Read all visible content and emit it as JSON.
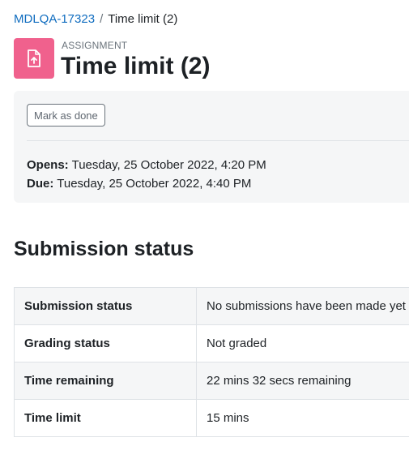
{
  "breadcrumb": {
    "course": "MDLQA-17323",
    "separator": "/",
    "current": "Time limit (2)"
  },
  "header": {
    "module_icon": "assignment-upload-icon",
    "module_icon_color": "#f0618d",
    "module_type": "ASSIGNMENT",
    "title": "Time limit (2)"
  },
  "activity": {
    "mark_done_label": "Mark as done",
    "opens_label": "Opens:",
    "opens_value": "Tuesday, 25 October 2022, 4:20 PM",
    "due_label": "Due:",
    "due_value": "Tuesday, 25 October 2022, 4:40 PM"
  },
  "submission": {
    "title": "Submission status",
    "rows": [
      {
        "label": "Submission status",
        "value": "No submissions have been made yet"
      },
      {
        "label": "Grading status",
        "value": "Not graded"
      },
      {
        "label": "Time remaining",
        "value": "22 mins 32 secs remaining"
      },
      {
        "label": "Time limit",
        "value": "15 mins"
      }
    ]
  },
  "colors": {
    "link": "#0f6cbf",
    "panel_bg": "#f5f6f7"
  }
}
